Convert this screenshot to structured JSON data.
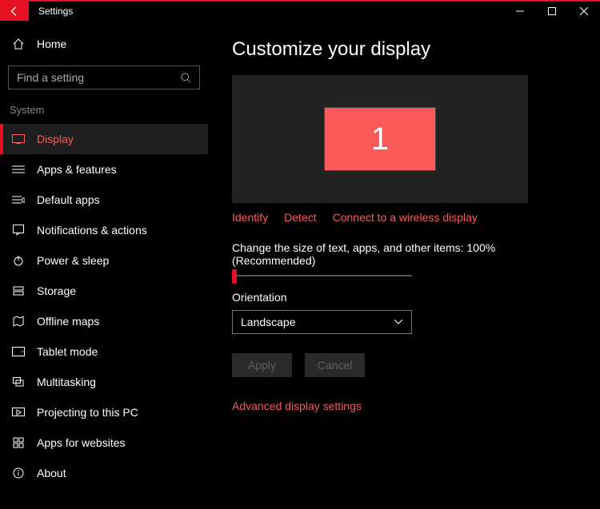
{
  "titlebar": {
    "title": "Settings"
  },
  "sidebar": {
    "home": "Home",
    "search_placeholder": "Find a setting",
    "section": "System",
    "items": [
      {
        "label": "Display"
      },
      {
        "label": "Apps & features"
      },
      {
        "label": "Default apps"
      },
      {
        "label": "Notifications & actions"
      },
      {
        "label": "Power & sleep"
      },
      {
        "label": "Storage"
      },
      {
        "label": "Offline maps"
      },
      {
        "label": "Tablet mode"
      },
      {
        "label": "Multitasking"
      },
      {
        "label": "Projecting to this PC"
      },
      {
        "label": "Apps for websites"
      },
      {
        "label": "About"
      }
    ]
  },
  "main": {
    "title": "Customize your display",
    "monitor_number": "1",
    "identify": "Identify",
    "detect": "Detect",
    "connect_wireless": "Connect to a wireless display",
    "scale_label": "Change the size of text, apps, and other items: 100% (Recommended)",
    "orientation_label": "Orientation",
    "orientation_value": "Landscape",
    "apply": "Apply",
    "cancel": "Cancel",
    "advanced": "Advanced display settings"
  }
}
